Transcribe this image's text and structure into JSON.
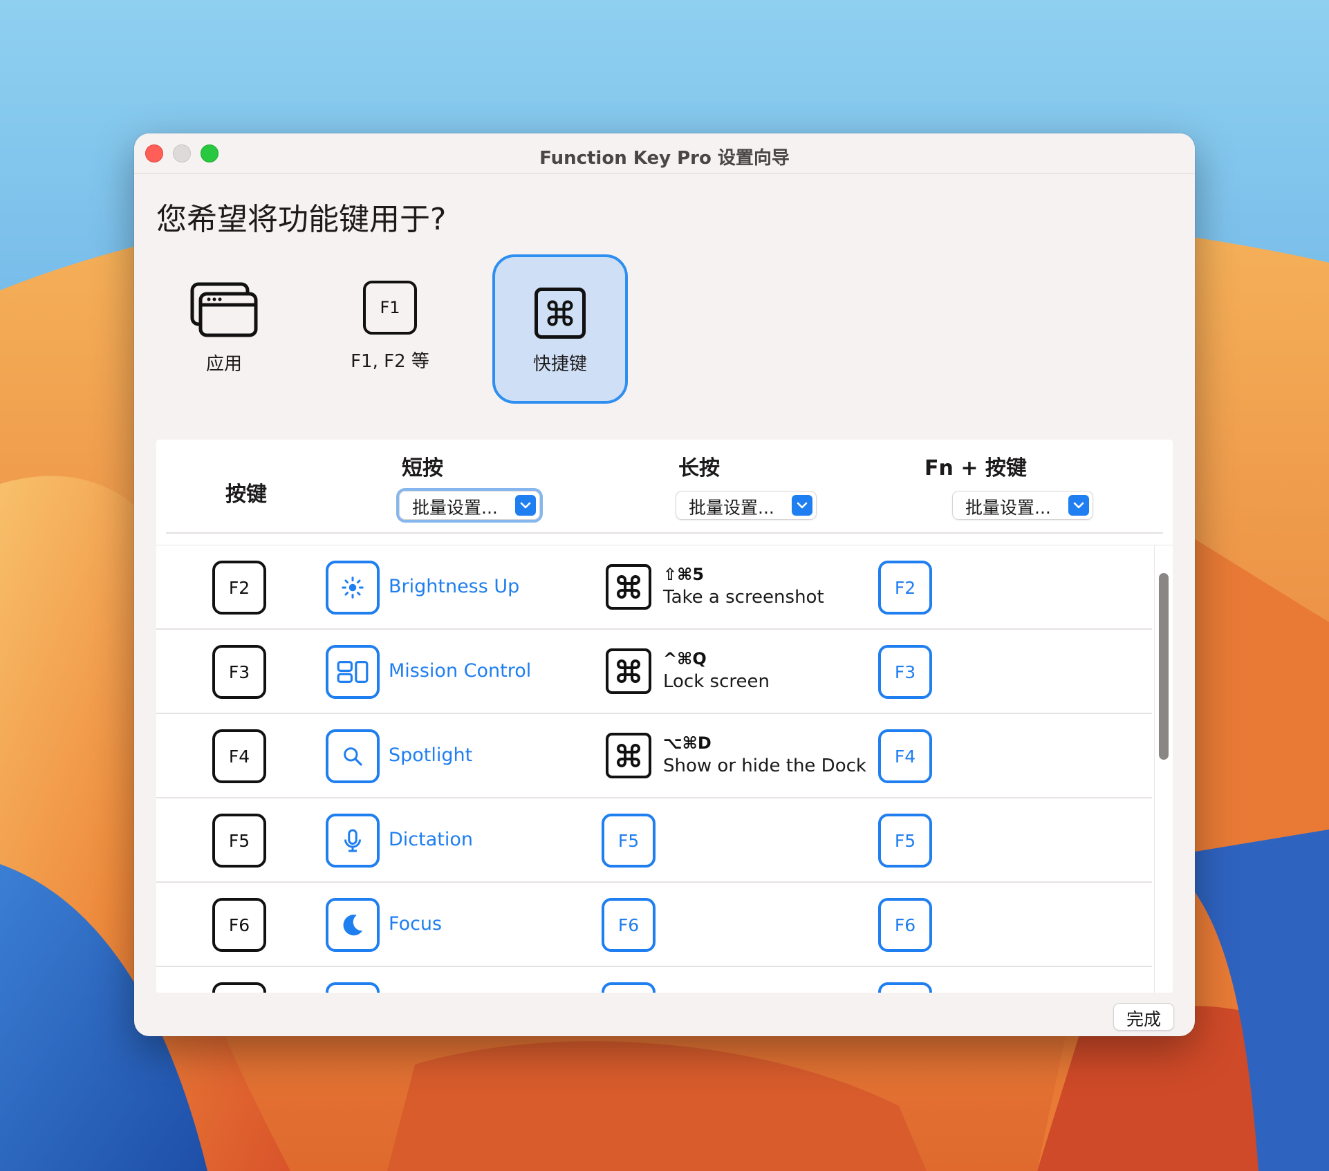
{
  "window": {
    "title": "Function Key Pro 设置向导"
  },
  "question": "您希望将功能键用于?",
  "modes": [
    {
      "label": "应用",
      "icon": "app-window-icon"
    },
    {
      "label": "F1, F2 等",
      "icon": "f1-key-icon",
      "key": "F1"
    },
    {
      "label": "快捷键",
      "icon": "command-key-icon",
      "selected": true
    }
  ],
  "table": {
    "headers": {
      "key": "按键",
      "short": "短按",
      "long": "长按",
      "fn": "Fn + 按键"
    },
    "batch": {
      "short": "批量设置...",
      "long": "批量设置...",
      "fn": "批量设置..."
    },
    "rows": [
      {
        "key": "F2",
        "short_icon": "brightness-up-icon",
        "short": "Brightness Up",
        "long_type": "shortcut",
        "long_combo": "⇧⌘5",
        "long_desc": "Take a screenshot",
        "fn": "F2"
      },
      {
        "key": "F3",
        "short_icon": "mission-control-icon",
        "short": "Mission Control",
        "long_type": "shortcut",
        "long_combo": "^⌘Q",
        "long_desc": "Lock screen",
        "fn": "F3"
      },
      {
        "key": "F4",
        "short_icon": "spotlight-icon",
        "short": "Spotlight",
        "long_type": "shortcut",
        "long_combo": "⌥⌘D",
        "long_desc": "Show or hide the Dock",
        "fn": "F4"
      },
      {
        "key": "F5",
        "short_icon": "microphone-icon",
        "short": "Dictation",
        "long_type": "key",
        "long_key": "F5",
        "fn": "F5"
      },
      {
        "key": "F6",
        "short_icon": "moon-icon",
        "short": "Focus",
        "long_type": "key",
        "long_key": "F6",
        "fn": "F6"
      }
    ]
  },
  "footer": {
    "done": "完成"
  },
  "colors": {
    "accent": "#1f7ef0",
    "selected_bg": "#cfe0f6",
    "close": "#ff5f57",
    "maximize": "#28c840"
  }
}
